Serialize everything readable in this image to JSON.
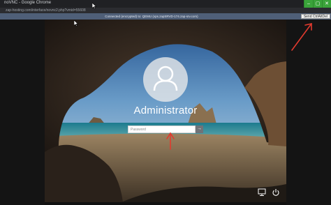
{
  "browser": {
    "window_title": "noVNC - Google Chrome",
    "url": "zap-hosting.com/interface/novnc2.php?vmid=55608",
    "controls": [
      "–",
      "▢",
      "✕"
    ]
  },
  "novnc": {
    "status": "Connected (encrypted) to: QEMU (vps.zapSRVD-174.zap-srv.com)",
    "send_cad_label": "Send CtrlAltDel"
  },
  "lock_screen": {
    "username": "Administrator",
    "password_placeholder": "Password",
    "submit_glyph": "→",
    "icons": [
      "network-icon",
      "ease-of-access-icon",
      "power-icon"
    ]
  },
  "annotations": {
    "arrow_color": "#e23a2e"
  }
}
